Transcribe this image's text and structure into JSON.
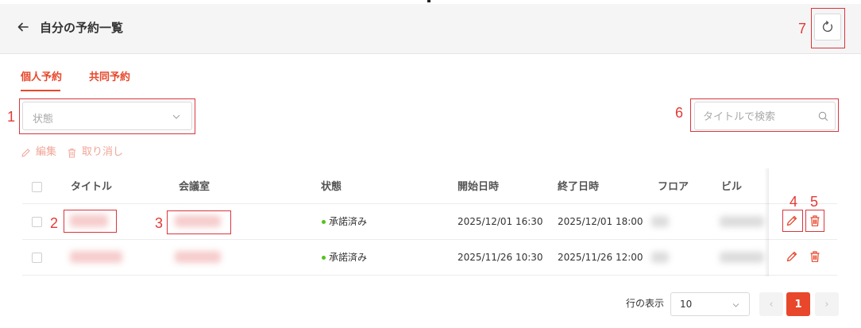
{
  "header": {
    "title": "自分の予約一覧"
  },
  "tabs": [
    {
      "label": "個人予約"
    },
    {
      "label": "共同予約"
    }
  ],
  "filters": {
    "status_placeholder": "状態",
    "search_placeholder": "タイトルで検索"
  },
  "toolbar": {
    "edit_label": "編集",
    "cancel_label": "取り消し"
  },
  "table": {
    "columns": [
      "タイトル",
      "会議室",
      "状態",
      "開始日時",
      "終了日時",
      "フロア",
      "ビル"
    ],
    "rows": [
      {
        "status": "承諾済み",
        "start": "2025/12/01 16:30",
        "end": "2025/12/01 18:00"
      },
      {
        "status": "承諾済み",
        "start": "2025/11/26 10:30",
        "end": "2025/11/26 12:00"
      }
    ]
  },
  "pagination": {
    "rows_label": "行の表示",
    "page_size": "10",
    "prev": "‹",
    "next": "›",
    "current_page": "1"
  },
  "annotations": [
    "1",
    "2",
    "3",
    "4",
    "5",
    "6",
    "7"
  ],
  "colors": {
    "accent": "#e8472b",
    "annotation": "#e53935",
    "status_ok": "#52c41a"
  }
}
